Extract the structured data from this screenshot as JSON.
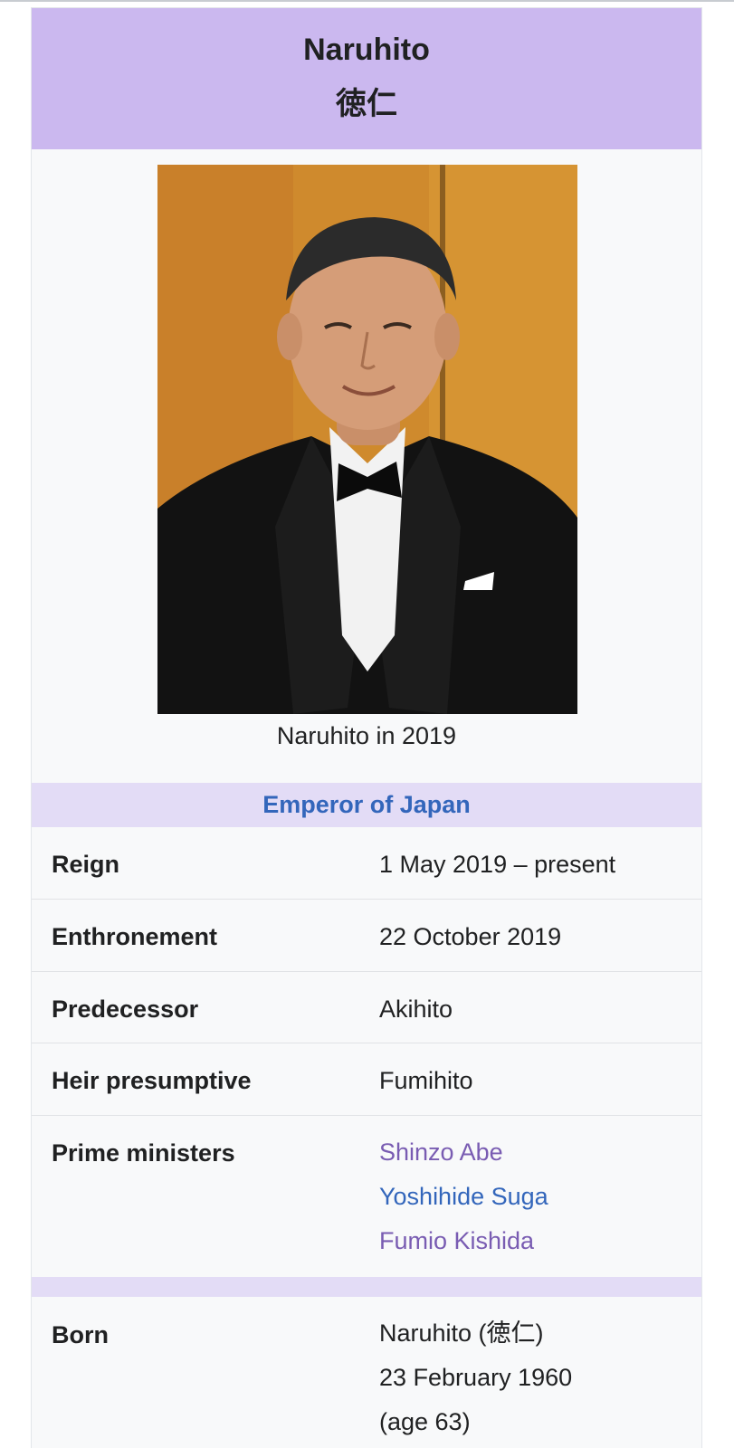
{
  "infobox": {
    "title": "Naruhito",
    "native_name": "徳仁",
    "image": {
      "caption": "Naruhito in 2019"
    },
    "section_title": "Emperor of Japan",
    "rows": {
      "reign": {
        "label": "Reign",
        "value": "1 May 2019 – present"
      },
      "enthronement": {
        "label": "Enthronement",
        "value": "22 October 2019"
      },
      "predecessor": {
        "label": "Predecessor",
        "value": "Akihito"
      },
      "heir": {
        "label": "Heir presumptive",
        "value": "Fumihito"
      },
      "prime_ministers": {
        "label": "Prime ministers",
        "values": [
          "Shinzo Abe",
          "Yoshihide Suga",
          "Fumio Kishida"
        ]
      },
      "born": {
        "label": "Born",
        "lines": [
          "Naruhito (徳仁)",
          "23 February 1960",
          "(age 63)"
        ]
      }
    },
    "colors": {
      "header_bg": "#cbb8ef",
      "section_bg": "#e3dcf6",
      "link": "#3366bb",
      "visited_link": "#795cb2",
      "text": "#202122",
      "box_bg": "#f8f9fa"
    }
  }
}
